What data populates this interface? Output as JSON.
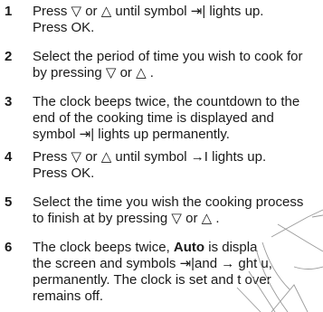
{
  "steps": [
    {
      "num": "1",
      "lines": [
        "Press ▽ or △ until symbol ⇥| lights up.",
        "Press OK."
      ]
    },
    {
      "num": "2",
      "lines": [
        "Select the period of time you wish to cook for",
        "by pressing ▽ or △ ."
      ]
    },
    {
      "num": "3",
      "lines": [
        "The clock beeps twice, the countdown to the",
        "end of the cooking time is displayed and",
        "symbol ⇥| lights up permanently."
      ]
    },
    {
      "num": "4",
      "lines": [
        "Press ▽ or △ until symbol →I lights up.",
        "Press OK."
      ]
    },
    {
      "num": "5",
      "lines": [
        "Select the time you wish the cooking process",
        "to finish at by pressing ▽ or △ ."
      ]
    },
    {
      "num": "6",
      "lines": [
        "The clock beeps twice, ",
        "Auto",
        " is displa",
        "the screen and symbols ⇥|and → ght u,",
        "permanently. The clock is set and t over",
        "remains off."
      ]
    }
  ],
  "overlay": {
    "fragment_1": "ght u,",
    "fragment_2": "over"
  }
}
